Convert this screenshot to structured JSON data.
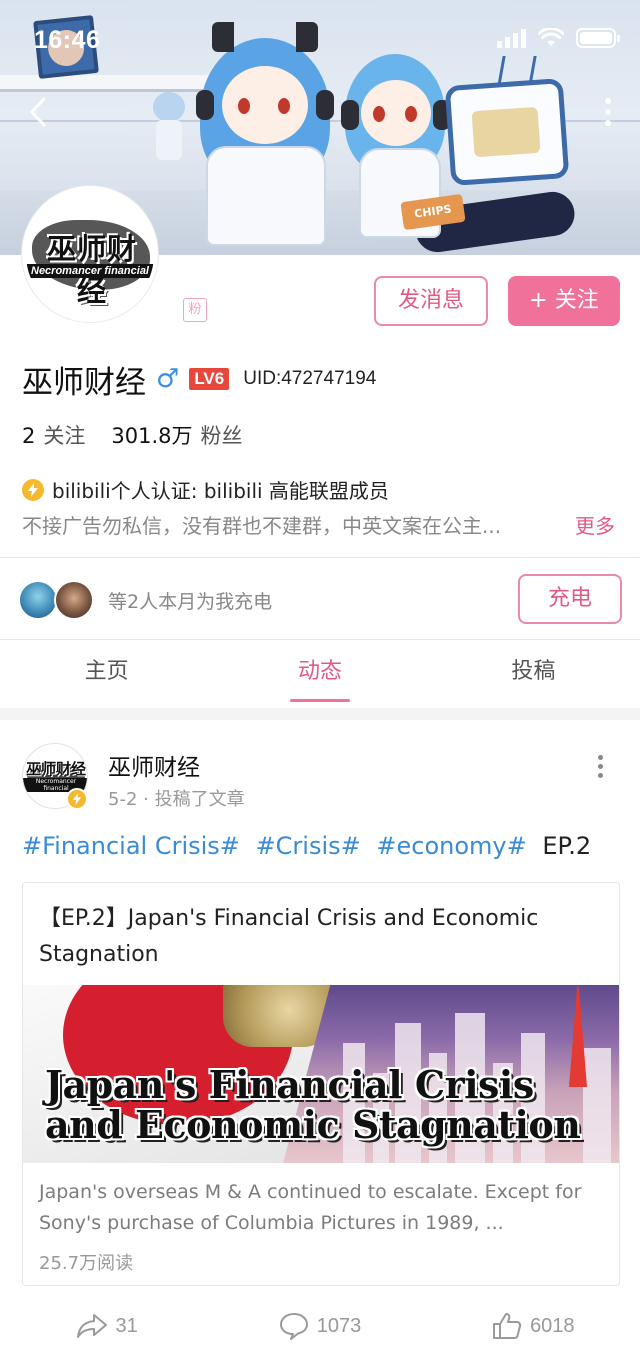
{
  "status_bar": {
    "time": "16:46"
  },
  "icons": {
    "back": "chevron-left-icon",
    "more": "more-vertical-icon",
    "gender": "male-icon",
    "verified": "lightning-badge-icon",
    "share": "share-arrow-icon",
    "comment": "comment-bubble-icon",
    "like": "thumbs-up-icon"
  },
  "banner": {
    "chips_text": "CHIPS"
  },
  "profile": {
    "avatar_text_cn": "巫师财经",
    "avatar_text_en": "Necromancer financial",
    "fan_badge": "粉",
    "message_button": "发消息",
    "follow_button": "+ 关注",
    "name": "巫师财经",
    "gender_symbol": "♂",
    "level": "LV6",
    "uid": "UID:472747194",
    "following_count": "2",
    "following_label": "关注",
    "followers_count": "301.8万",
    "followers_label": "粉丝",
    "verification": "bilibili个人认证: bilibili 高能联盟成员",
    "bio": "不接广告勿私信，没有群也不建群，中英文案在公主...",
    "bio_more": "更多"
  },
  "charge": {
    "text": "等2人本月为我充电",
    "button": "充电"
  },
  "tabs": [
    {
      "label": "主页",
      "active": false
    },
    {
      "label": "动态",
      "active": true
    },
    {
      "label": "投稿",
      "active": false
    }
  ],
  "post": {
    "author": "巫师财经",
    "meta": "5-2 · 投稿了文章",
    "tags": [
      "#Financial Crisis#",
      "#Crisis#",
      "#economy#"
    ],
    "tag_suffix": "EP.2",
    "article": {
      "title": "【EP.2】Japan's Financial Crisis and Economic Stagnation",
      "cover_title_line1": "Japan's Financial Crisis",
      "cover_title_line2": "and Economic Stagnation",
      "summary": "Japan's overseas M & A continued to escalate. Except for Sony's purchase of Columbia Pictures in 1989, ...",
      "reads": "25.7万阅读"
    },
    "shares": "31",
    "comments": "1073",
    "likes": "6018"
  },
  "colors": {
    "accent_pink": "#f0719a",
    "accent_pink_text": "#e05b84",
    "tag_blue": "#3a8bd4",
    "level_red": "#e8473c",
    "verify_gold": "#f5b82e"
  }
}
